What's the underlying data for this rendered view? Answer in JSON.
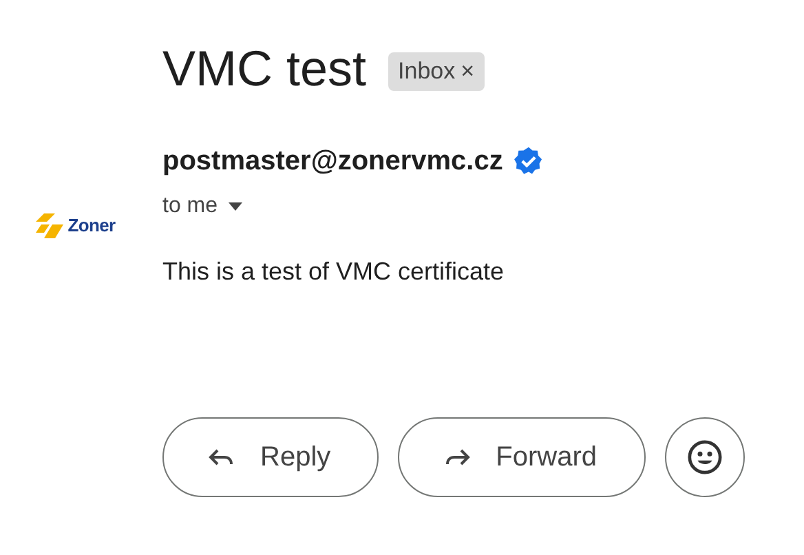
{
  "subject": "VMC test",
  "label": {
    "text": "Inbox",
    "remove": "×"
  },
  "sender": {
    "logo_text": "Zoner",
    "address": "postmaster@zonervmc.cz",
    "verified": true,
    "recipient": "to me"
  },
  "body": "This is a test of VMC certificate",
  "actions": [
    {
      "kind": "reply",
      "label": "Reply"
    },
    {
      "kind": "forward",
      "label": "Forward"
    },
    {
      "kind": "emoji"
    }
  ]
}
